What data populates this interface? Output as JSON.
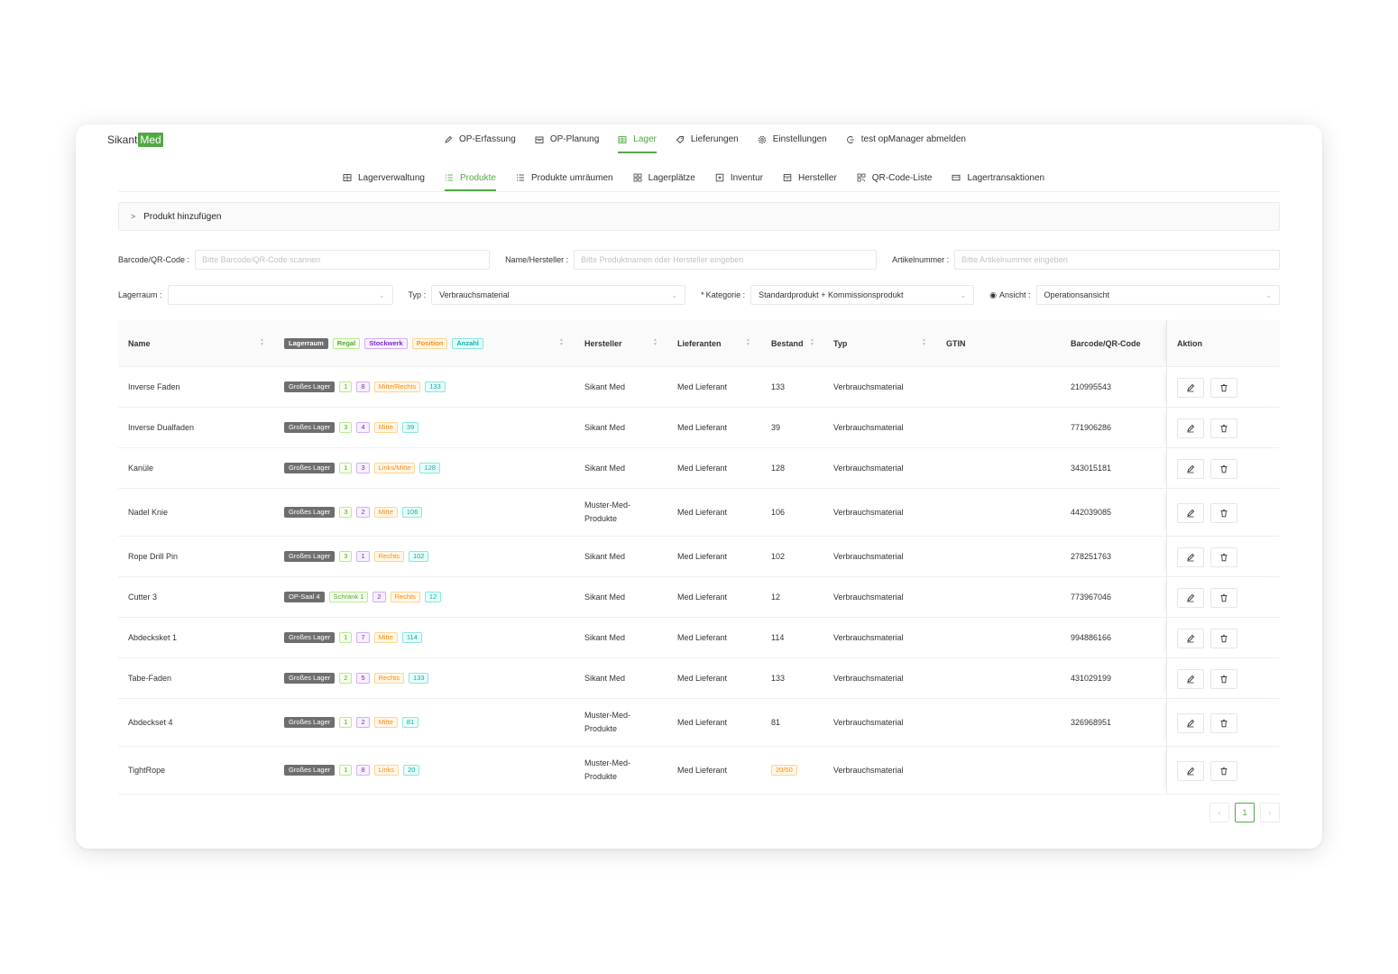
{
  "brand": {
    "name_left": "Sikant",
    "name_right": "Med"
  },
  "main_nav": [
    {
      "label": "OP-Erfassung",
      "icon": "pencil-icon"
    },
    {
      "label": "OP-Planung",
      "icon": "calendar-icon"
    },
    {
      "label": "Lager",
      "icon": "warehouse-icon",
      "active": true
    },
    {
      "label": "Lieferungen",
      "icon": "tag-icon"
    },
    {
      "label": "Einstellungen",
      "icon": "gear-icon"
    },
    {
      "label": "test opManager abmelden",
      "icon": "logout-icon"
    }
  ],
  "sub_nav": [
    {
      "label": "Lagerverwaltung",
      "icon": "grid-icon"
    },
    {
      "label": "Produkte",
      "icon": "list-icon",
      "active": true
    },
    {
      "label": "Produkte umräumen",
      "icon": "list-icon"
    },
    {
      "label": "Lagerplätze",
      "icon": "apps-icon"
    },
    {
      "label": "Inventur",
      "icon": "inventory-icon"
    },
    {
      "label": "Hersteller",
      "icon": "building-icon"
    },
    {
      "label": "QR-Code-Liste",
      "icon": "qrcode-icon"
    },
    {
      "label": "Lagertransaktionen",
      "icon": "transaction-icon"
    }
  ],
  "add_product": {
    "label": "Produkt hinzufügen"
  },
  "filters": {
    "barcode_label": "Barcode/QR-Code",
    "barcode_placeholder": "Bitte Barcode/QR-Code scannen",
    "name_label": "Name/Hersteller",
    "name_placeholder": "Bitte Produktnamen oder Hersteller eingeben",
    "article_label": "Artikelnummer",
    "article_placeholder": "Bitte Artikelnummer eingeben",
    "lagerraum_label": "Lagerraum",
    "lagerraum_value": "",
    "typ_label": "Typ",
    "typ_value": "Verbrauchsmaterial",
    "kategorie_label": "Kategorie",
    "kategorie_value": "Standardprodukt + Kommissionsprodukt",
    "ansicht_label": "Ansicht",
    "ansicht_value": "Operationsansicht"
  },
  "table": {
    "headers": {
      "name": "Name",
      "tag_lagerraum": "Lagerraum",
      "tag_regal": "Regal",
      "tag_stockwerk": "Stockwerk",
      "tag_position": "Position",
      "tag_anzahl": "Anzahl",
      "hersteller": "Hersteller",
      "lieferanten": "Lieferanten",
      "bestand": "Bestand",
      "typ": "Typ",
      "gtin": "GTIN",
      "barcode": "Barcode/QR-Code",
      "aktion": "Aktion"
    },
    "rows": [
      {
        "name": "Inverse Faden",
        "room": "Großes Lager",
        "regal": "1",
        "stockwerk": "8",
        "position": "Mitte/Rechts",
        "anzahl": "133",
        "hersteller": "Sikant Med",
        "lieferant": "Med Lieferant",
        "bestand": "133",
        "bestand_warn": false,
        "typ": "Verbrauchsmaterial",
        "gtin": "",
        "barcode": "210995543"
      },
      {
        "name": "Inverse Dualfaden",
        "room": "Großes Lager",
        "regal": "3",
        "stockwerk": "4",
        "position": "Mitte",
        "anzahl": "39",
        "hersteller": "Sikant Med",
        "lieferant": "Med Lieferant",
        "bestand": "39",
        "bestand_warn": false,
        "typ": "Verbrauchsmaterial",
        "gtin": "",
        "barcode": "771906286"
      },
      {
        "name": "Kanüle",
        "room": "Großes Lager",
        "regal": "1",
        "stockwerk": "3",
        "position": "Links/Mitte",
        "anzahl": "128",
        "hersteller": "Sikant Med",
        "lieferant": "Med Lieferant",
        "bestand": "128",
        "bestand_warn": false,
        "typ": "Verbrauchsmaterial",
        "gtin": "",
        "barcode": "343015181"
      },
      {
        "name": "Nadel Knie",
        "room": "Großes Lager",
        "regal": "3",
        "stockwerk": "2",
        "position": "Mitte",
        "anzahl": "106",
        "hersteller": "Muster-Med-Produkte",
        "lieferant": "Med Lieferant",
        "bestand": "106",
        "bestand_warn": false,
        "typ": "Verbrauchsmaterial",
        "gtin": "",
        "barcode": "442039085"
      },
      {
        "name": "Rope Drill Pin",
        "room": "Großes Lager",
        "regal": "3",
        "stockwerk": "1",
        "position": "Rechts",
        "anzahl": "102",
        "hersteller": "Sikant Med",
        "lieferant": "Med Lieferant",
        "bestand": "102",
        "bestand_warn": false,
        "typ": "Verbrauchsmaterial",
        "gtin": "",
        "barcode": "278251763"
      },
      {
        "name": "Cutter 3",
        "room": "OP-Saal 4",
        "regal": "Schrank 1",
        "stockwerk": "2",
        "position": "Rechts",
        "anzahl": "12",
        "hersteller": "Sikant Med",
        "lieferant": "Med Lieferant",
        "bestand": "12",
        "bestand_warn": false,
        "typ": "Verbrauchsmaterial",
        "gtin": "",
        "barcode": "773967046"
      },
      {
        "name": "Abdecksket 1",
        "room": "Großes Lager",
        "regal": "1",
        "stockwerk": "7",
        "position": "Mitte",
        "anzahl": "114",
        "hersteller": "Sikant Med",
        "lieferant": "Med Lieferant",
        "bestand": "114",
        "bestand_warn": false,
        "typ": "Verbrauchsmaterial",
        "gtin": "",
        "barcode": "994886166"
      },
      {
        "name": "Tabe-Faden",
        "room": "Großes Lager",
        "regal": "2",
        "stockwerk": "5",
        "position": "Rechts",
        "anzahl": "133",
        "hersteller": "Sikant Med",
        "lieferant": "Med Lieferant",
        "bestand": "133",
        "bestand_warn": false,
        "typ": "Verbrauchsmaterial",
        "gtin": "",
        "barcode": "431029199"
      },
      {
        "name": "Abdeckset 4",
        "room": "Großes Lager",
        "regal": "1",
        "stockwerk": "2",
        "position": "Mitte",
        "anzahl": "81",
        "hersteller": "Muster-Med-Produkte",
        "lieferant": "Med Lieferant",
        "bestand": "81",
        "bestand_warn": false,
        "typ": "Verbrauchsmaterial",
        "gtin": "",
        "barcode": "326968951"
      },
      {
        "name": "TightRope",
        "room": "Großes Lager",
        "regal": "1",
        "stockwerk": "8",
        "position": "Links",
        "anzahl": "20",
        "hersteller": "Muster-Med-Produkte",
        "lieferant": "Med Lieferant",
        "bestand": "20/50",
        "bestand_warn": true,
        "typ": "Verbrauchsmaterial",
        "gtin": "",
        "barcode": ""
      }
    ]
  },
  "pagination": {
    "prev": "‹",
    "current": "1",
    "next": "›"
  },
  "colors": {
    "accent": "#53a846",
    "room_tag": "#6e6e6e",
    "warn": "#fa8c16"
  }
}
